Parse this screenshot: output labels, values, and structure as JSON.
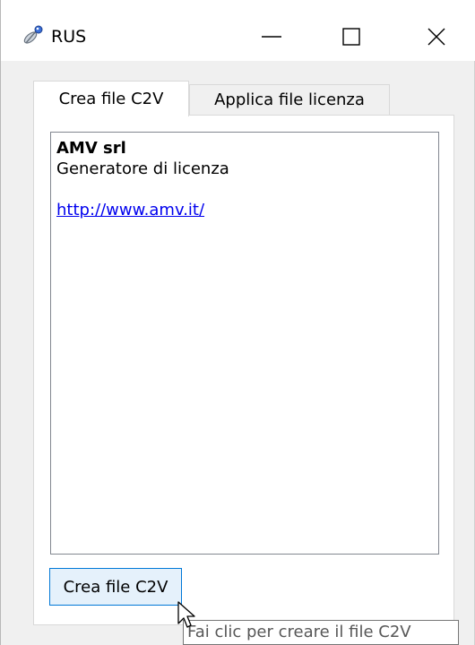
{
  "window": {
    "title": "RUS",
    "app_icon": "satellite-icon",
    "controls": {
      "minimize": "minimize-icon",
      "maximize": "maximize-icon",
      "close": "close-icon"
    }
  },
  "tabs": [
    {
      "label": "Crea file C2V",
      "active": true
    },
    {
      "label": "Applica file licenza",
      "active": false
    }
  ],
  "info": {
    "company": "AMV srl",
    "description": "Generatore di licenza",
    "link": "http://www.amv.it/"
  },
  "action_button": {
    "label": "Crea file C2V"
  },
  "tooltip": {
    "text": "Fai clic per creare il file C2V"
  },
  "colors": {
    "link": "#0000ee",
    "button_focus_border": "#0078d7",
    "button_bg": "#e5f1fb"
  }
}
